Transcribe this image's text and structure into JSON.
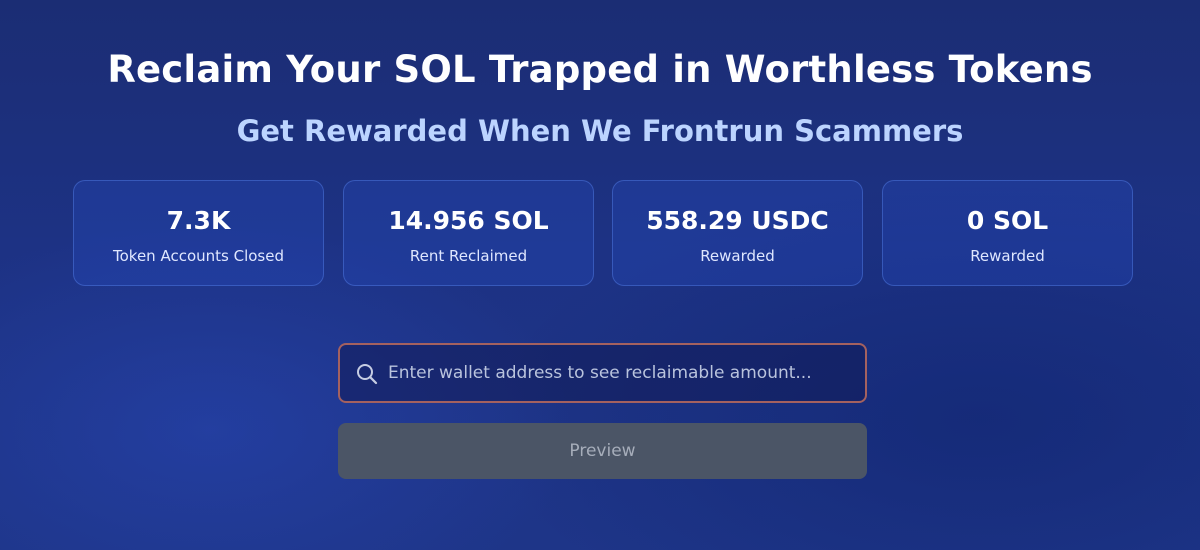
{
  "header": {
    "title": "Reclaim Your SOL Trapped in Worthless Tokens",
    "subtitle": "Get Rewarded When We Frontrun Scammers"
  },
  "stats": [
    {
      "value": "7.3K",
      "label": "Token Accounts Closed"
    },
    {
      "value": "14.956 SOL",
      "label": "Rent Reclaimed"
    },
    {
      "value": "558.29 USDC",
      "label": "Rewarded"
    },
    {
      "value": "0 SOL",
      "label": "Rewarded"
    }
  ],
  "search": {
    "icon": "search-icon",
    "value": "",
    "placeholder": "Enter wallet address to see reclaimable amount..."
  },
  "preview_button": {
    "label": "Preview",
    "state": "disabled"
  },
  "colors": {
    "background": "#1d3284",
    "subtitle": "#bcd4ff",
    "input_border": "#a4615f",
    "button_bg": "#4b5566",
    "button_text": "#a6adba"
  }
}
